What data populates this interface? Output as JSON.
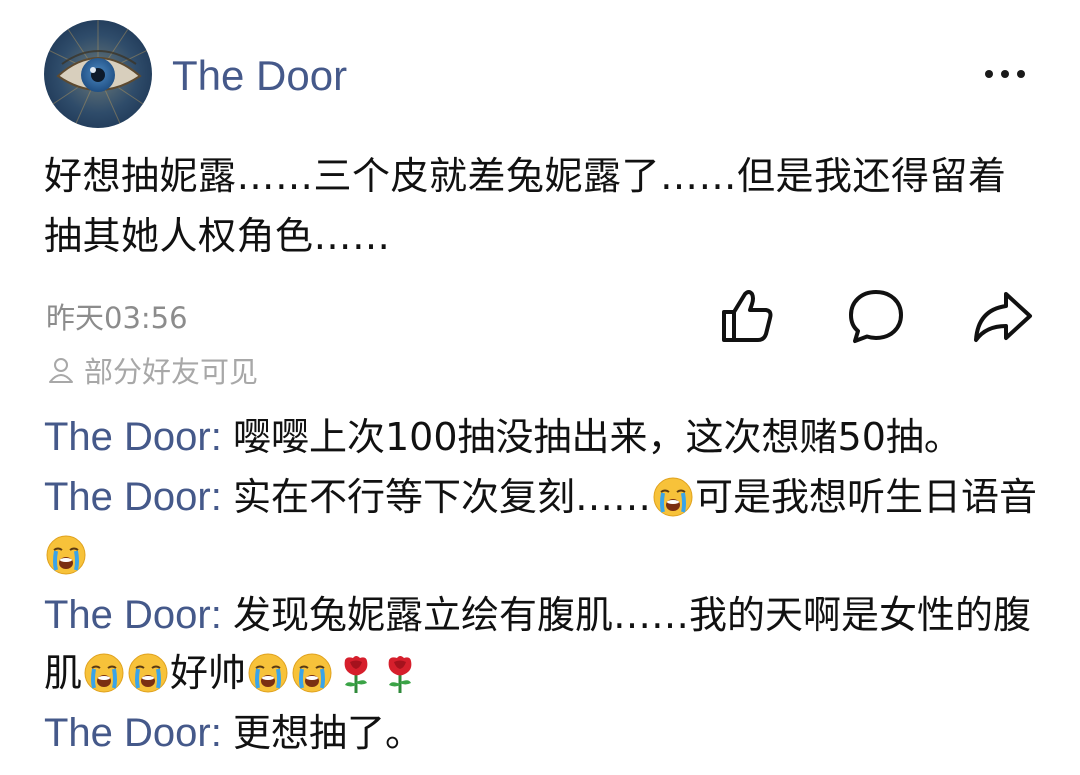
{
  "post": {
    "author": "The Door",
    "text": "好想抽妮露……三个皮就差兔妮露了……但是我还得留着抽其她人权角色……",
    "timestamp": "昨天03:56",
    "visibility": "部分好友可见"
  },
  "comments": [
    {
      "author": "The Door",
      "separator": ": ",
      "parts": [
        {
          "t": "text",
          "v": "嘤嘤上次100抽没抽出来，这次想赌50抽。"
        }
      ]
    },
    {
      "author": "The Door",
      "separator": ": ",
      "parts": [
        {
          "t": "text",
          "v": "实在不行等下次复刻……"
        },
        {
          "t": "emoji",
          "v": "crying-emoji"
        },
        {
          "t": "text",
          "v": "可是我想听生日语音"
        },
        {
          "t": "emoji",
          "v": "crying-emoji"
        }
      ]
    },
    {
      "author": "The Door",
      "separator": ": ",
      "parts": [
        {
          "t": "text",
          "v": "发现兔妮露立绘有腹肌……我的天啊是女性的腹肌"
        },
        {
          "t": "emoji",
          "v": "crying-emoji"
        },
        {
          "t": "emoji",
          "v": "crying-emoji"
        },
        {
          "t": "text",
          "v": "好帅"
        },
        {
          "t": "emoji",
          "v": "crying-emoji"
        },
        {
          "t": "emoji",
          "v": "crying-emoji"
        },
        {
          "t": "emoji",
          "v": "rose-emoji"
        },
        {
          "t": "emoji",
          "v": "rose-emoji"
        }
      ]
    },
    {
      "author": "The Door",
      "separator": ": ",
      "parts": [
        {
          "t": "text",
          "v": "更想抽了。"
        }
      ]
    }
  ],
  "icons": {
    "avatar": "eye-avatar",
    "more": "more-icon",
    "like": "thumbs-up-icon",
    "comment": "comment-icon",
    "share": "share-icon",
    "visibility": "person-icon"
  },
  "colors": {
    "name": "#45598a",
    "meta": "#8c8c8c",
    "text": "#111111"
  }
}
